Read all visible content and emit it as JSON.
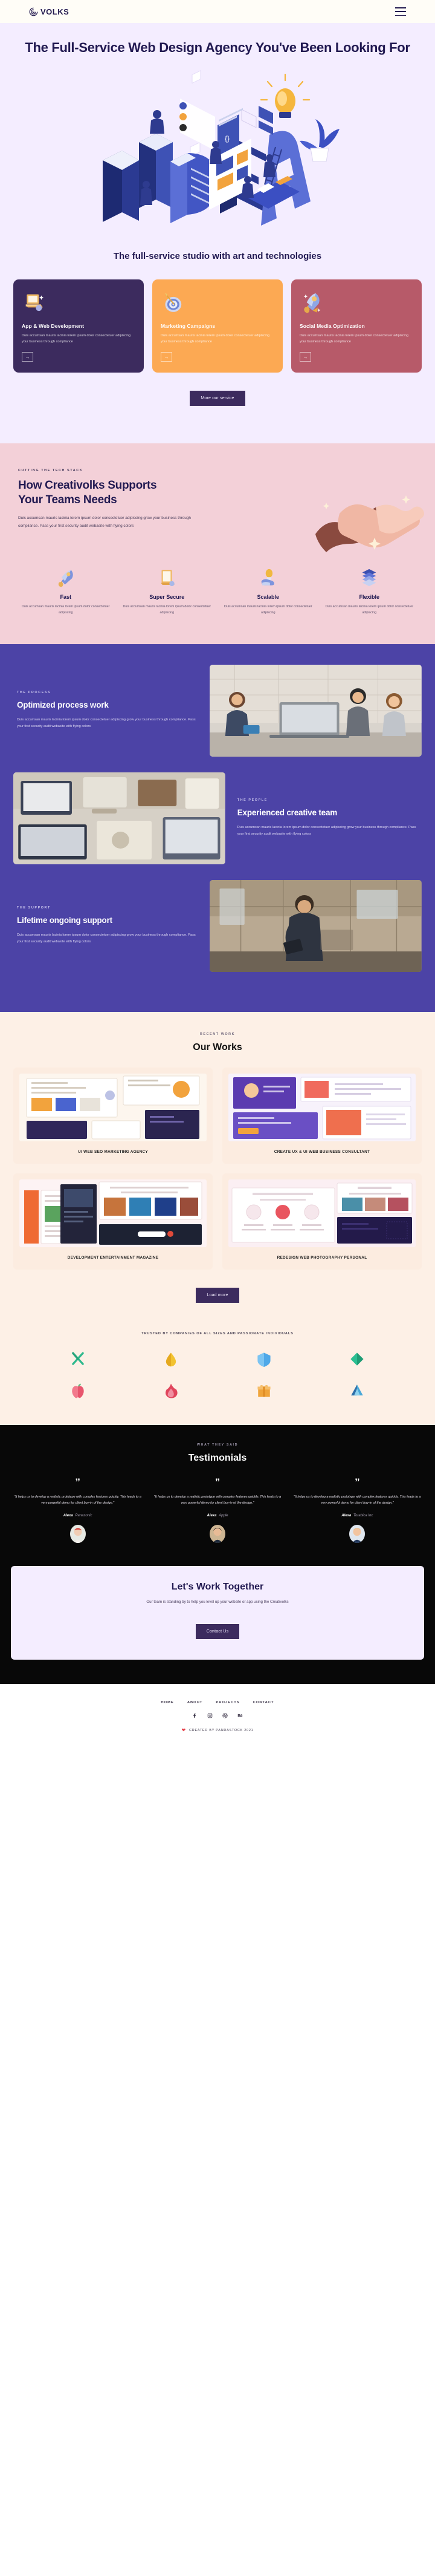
{
  "header": {
    "brand": "VOLKS",
    "logo_icon": "spiral-logo-icon",
    "menu_icon": "hamburger-menu-icon"
  },
  "hero": {
    "title": "The Full-Service Web Design Agency You've Been Looking For",
    "illustration": "isometric-idea-letters-illustration"
  },
  "services": {
    "heading": "The full-service studio with art and technologies",
    "cards": [
      {
        "title": "App & Web Development",
        "text": "Duis accumsan mauris lacinia lorem ipsum dolor consectetuer adipiscing your business through compliance",
        "icon": "laptop-3d-icon",
        "bg": "#3c2b5e",
        "arrow": "→"
      },
      {
        "title": "Marketing Campaigns",
        "text": "Duis accumsan mauris lacinia lorem ipsum dolor consectetuer adipiscing your business through compliance",
        "icon": "dartboard-3d-icon",
        "bg": "#fca953",
        "arrow": "→"
      },
      {
        "title": "Social Media Optimization",
        "text": "Duis accumsan mauris lacinia lorem ipsum dolor consectetuer adipiscing your business through compliance",
        "icon": "rocket-3d-icon",
        "bg": "#b75a69",
        "arrow": "→"
      }
    ],
    "cta_label": "More our service"
  },
  "support": {
    "eyebrow": "CUTTING THE TECH STACK",
    "heading": "How Creativolks Supports Your Teams Needs",
    "text": "Duis accumsan mauris lacinia lorem ipsum dolor consectetuer adipiscing grow your business through compliance. Pass your first security audit webasite with flying colors",
    "illustration": "handshake-3d-illustration",
    "features": [
      {
        "title": "Fast",
        "text": "Duis accumsan mauris lacinia lorem ipsum dolor consectetuer adipiscing",
        "icon": "rocket-pen-3d-icon"
      },
      {
        "title": "Super Secure",
        "text": "Duis accumsan mauris lacinia lorem ipsum dolor consectetuer adipiscing",
        "icon": "document-3d-icon"
      },
      {
        "title": "Scalable",
        "text": "Duis accumsan mauris lacinia lorem ipsum dolor consectetuer adipiscing",
        "icon": "hand-bulb-3d-icon"
      },
      {
        "title": "Flexible",
        "text": "Duis accumsan mauris lacinia lorem ipsum dolor consectetuer adipiscing",
        "icon": "layers-3d-icon"
      }
    ]
  },
  "process": {
    "blocks": [
      {
        "eyebrow": "THE PROCESS",
        "heading": "Optimized process work",
        "text": "Duis accumsan mauris lacinia lorem ipsum dolor consectetuer adipiscing grow your business through compliance. Pass your first security audit webasite with flying colors",
        "photo": "team-at-desk-photo"
      },
      {
        "eyebrow": "THE PEOPLE",
        "heading": "Experienced creative team",
        "text": "Duis accumsan mauris lacinia lorem ipsum dolor consectetuer adipiscing grow your business through compliance. Pass your first security audit webasite with flying colors",
        "photo": "desk-flatlay-photo"
      },
      {
        "eyebrow": "THE SUPPORT",
        "heading": "Lifetime ongoing support",
        "text": "Duis accumsan mauris lacinia lorem ipsum dolor consectetuer adipiscing grow your business through compliance. Pass your first security audit webasite with flying colors",
        "photo": "man-with-tablet-photo"
      }
    ]
  },
  "works": {
    "eyebrow": "RECENT WORK",
    "heading": "Our Works",
    "items": [
      {
        "title": "UI WEB SEO MARKETING AGENCY",
        "thumb": "seo-marketing-screens-thumb"
      },
      {
        "title": "CREATE UX & UI WEB BUSINESS CONSULTANT",
        "thumb": "business-consultant-screens-thumb"
      },
      {
        "title": "DEVELOPMENT ENTERTAINMENT MAGAZINE",
        "thumb": "entertainment-magazine-screens-thumb"
      },
      {
        "title": "REDESIGN WEB PHOTOGRAPHY PERSONAL",
        "thumb": "photography-personal-screens-thumb"
      }
    ],
    "load_more_label": "Load more",
    "trusted_label": "TRUSTED BY COMPANIES OF ALL SIZES AND PASSIONATE INDIVIDUALS",
    "logos": [
      {
        "name": "scissors-logo",
        "color": "#2fb98d"
      },
      {
        "name": "droplet-logo",
        "color": "#f2c230"
      },
      {
        "name": "shield-logo",
        "color": "#4fa8e8"
      },
      {
        "name": "diamond-logo",
        "color": "#1f9d76"
      },
      {
        "name": "apple-logo",
        "color": "#e8556d"
      },
      {
        "name": "flame-logo",
        "color": "#e0455c"
      },
      {
        "name": "gift-box-logo",
        "color": "#f0a43a"
      },
      {
        "name": "atlas-logo",
        "color": "#4aa8d8"
      }
    ]
  },
  "testimonials": {
    "eyebrow": "WHAT THEY SAID",
    "heading": "Testimonials",
    "quote_mark": "”",
    "items": [
      {
        "text": "\"It helps us to develop a realistic prototype with complex features quickly. This leads to a very powerful demo for client buy-in of the design.\"",
        "name": "Alexa",
        "company": "Panasonic",
        "avatar": "avatar-woman-red-hat"
      },
      {
        "text": "\"It helps us to develop a realistic prototype with complex features quickly. This leads to a very powerful demo for client buy-in of the design.\"",
        "name": "Alexa",
        "company": "Apple",
        "avatar": "avatar-woman-dark-hair"
      },
      {
        "text": "\"It helps us to develop a realistic prototype with complex features quickly. This leads to a very powerful demo for client buy-in of the design.\"",
        "name": "Alexa",
        "company": "Torabica Inc",
        "avatar": "avatar-man-blond"
      }
    ]
  },
  "cta": {
    "heading": "Let's Work Together",
    "text": "Our team is standing by to help you level up your website or app using the Creativolks",
    "button_label": "Contact Us"
  },
  "footer": {
    "nav": [
      "HOME",
      "ABOUT",
      "PROJECTS",
      "CONTACT"
    ],
    "social": [
      "facebook-icon",
      "instagram-icon",
      "dribbble-icon",
      "behance-icon"
    ],
    "copyright": "CREATED BY PANDASTOCK 2021",
    "heart_icon": "heart-icon"
  }
}
